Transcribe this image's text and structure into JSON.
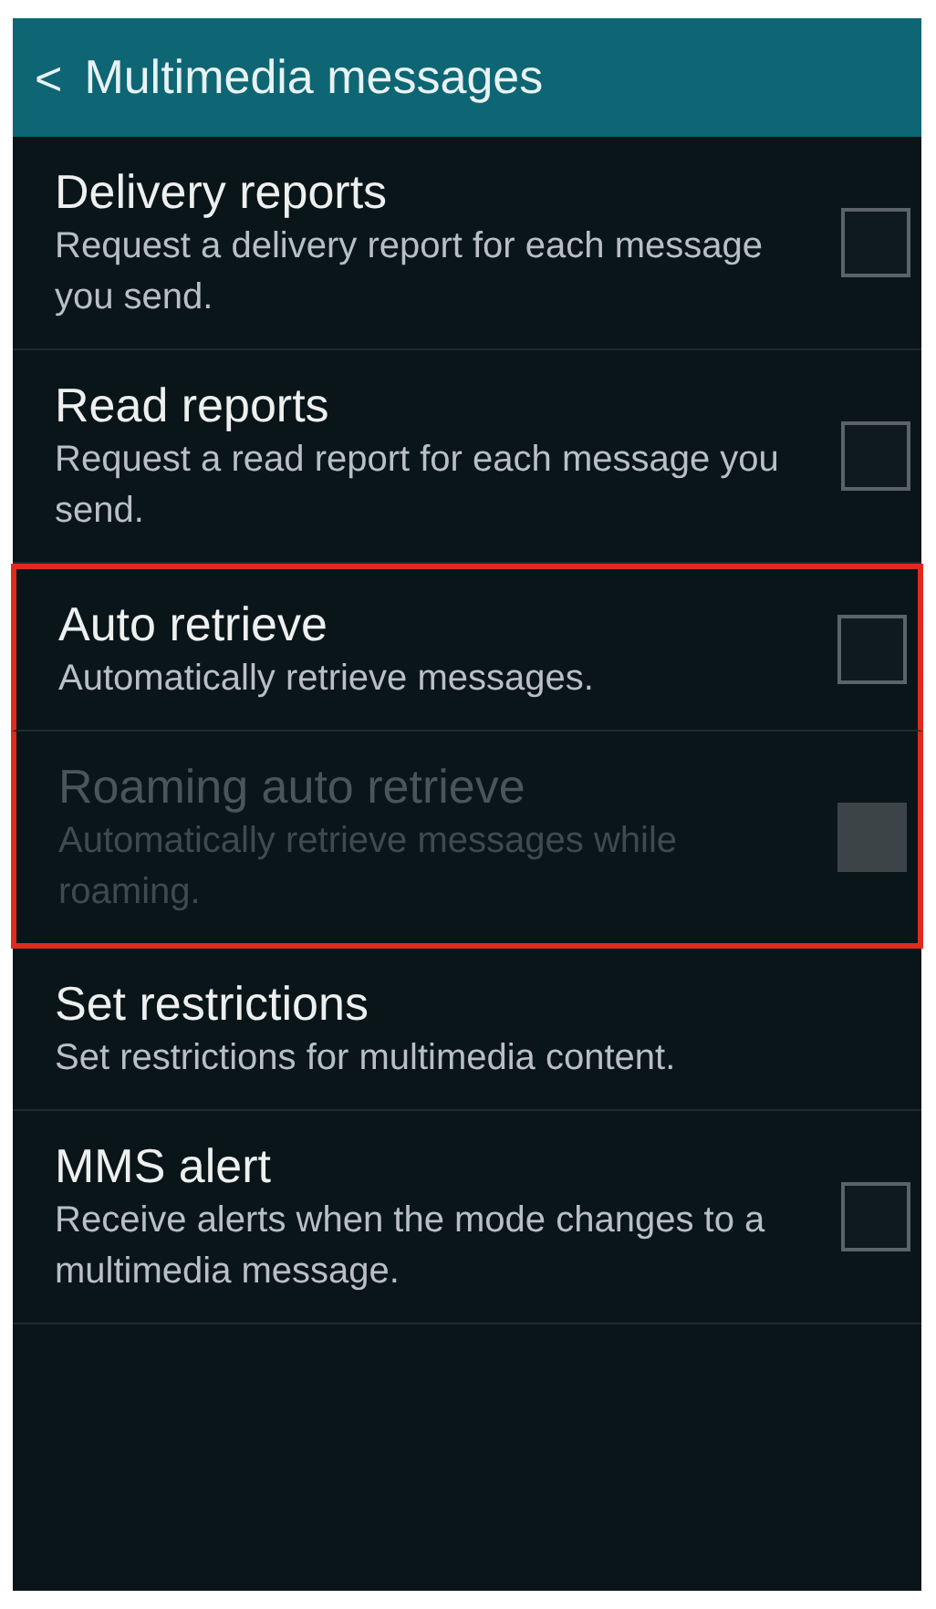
{
  "header": {
    "back": "<",
    "title": "Multimedia messages"
  },
  "items": [
    {
      "kind": "checkbox",
      "title": "Delivery reports",
      "summary": "Request a delivery report for each message you send.",
      "checked": false,
      "disabled": false,
      "highlighted": false
    },
    {
      "kind": "checkbox",
      "title": "Read reports",
      "summary": "Request a read report for each message you send.",
      "checked": false,
      "disabled": false,
      "highlighted": false
    },
    {
      "kind": "checkbox",
      "title": "Auto retrieve",
      "summary": "Automatically retrieve messages.",
      "checked": false,
      "disabled": false,
      "highlighted": true
    },
    {
      "kind": "checkbox",
      "title": "Roaming auto retrieve",
      "summary": "Automatically retrieve messages while roaming.",
      "checked": false,
      "disabled": true,
      "highlighted": true
    },
    {
      "kind": "link",
      "title": "Set restrictions",
      "summary": "Set restrictions for multimedia content.",
      "highlighted": false
    },
    {
      "kind": "checkbox",
      "title": "MMS alert",
      "summary": "Receive alerts when the mode changes to a multimedia message.",
      "checked": false,
      "disabled": false,
      "highlighted": false
    }
  ]
}
